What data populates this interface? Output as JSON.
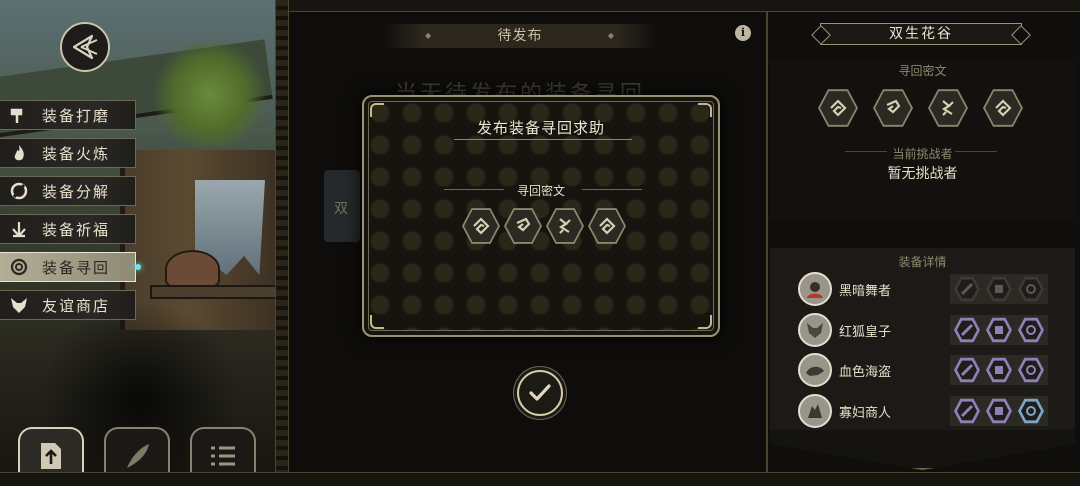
{
  "side_menu": {
    "items": [
      {
        "label": "装备打磨",
        "icon": "hammer-icon"
      },
      {
        "label": "装备火炼",
        "icon": "flame-icon"
      },
      {
        "label": "装备分解",
        "icon": "split-icon"
      },
      {
        "label": "装备祈福",
        "icon": "bless-icon"
      },
      {
        "label": "装备寻回",
        "icon": "spiral-icon",
        "active": true
      },
      {
        "label": "友谊商店",
        "icon": "fox-icon"
      }
    ]
  },
  "bottom_bar": {
    "buttons": [
      {
        "icon": "upload-icon",
        "active": true
      },
      {
        "icon": "feather-icon"
      },
      {
        "icon": "list-icon"
      }
    ]
  },
  "middle": {
    "tab_label": "待发布",
    "bg_heading": "当无待发布的装备寻回",
    "bg_card_text": "双"
  },
  "modal": {
    "title": "发布装备寻回求助",
    "subtitle": "寻回密文",
    "glyphs": [
      "spiral-glyph",
      "hook-glyph",
      "rune-glyph",
      "spiral-glyph"
    ]
  },
  "right_panel": {
    "title": "双生花谷",
    "cipher_label": "寻回密文",
    "glyphs": [
      "spiral-glyph",
      "hook-glyph",
      "rune-glyph",
      "spiral-glyph"
    ],
    "challenger_label": "当前挑战者",
    "challenger_value": "暂无挑战者",
    "equip_label": "装备详情",
    "heroes": [
      {
        "name": "黑暗舞者",
        "slots_active": false
      },
      {
        "name": "红狐皇子",
        "slots_active": true
      },
      {
        "name": "血色海盗",
        "slots_active": true
      },
      {
        "name": "寡妇商人",
        "slots_active": true
      }
    ]
  },
  "colors": {
    "accent_cyan": "#6be7ef",
    "slot_purple": "#8d82b8",
    "frame_gold": "#9b9175"
  }
}
